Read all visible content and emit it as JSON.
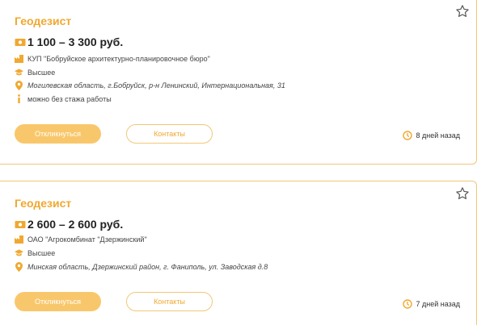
{
  "colors": {
    "accent": "#f0a830",
    "button_fill": "#f9c76b",
    "border": "#f0c878",
    "text": "#333333"
  },
  "vacancies": [
    {
      "title": "Геодезист",
      "salary": "1 100 – 3 300 руб.",
      "company": "КУП \"Бобруйское архитектурно-планировочное бюро\"",
      "education": "Высшее",
      "address": "Могилевская область, г.Бобруйск, р-н Ленинский, Интернациональная, 31",
      "experience": "можно без стажа работы",
      "apply_label": "Откликнуться",
      "contacts_label": "Контакты",
      "posted": "8 дней назад"
    },
    {
      "title": "Геодезист",
      "salary": "2 600 – 2 600 руб.",
      "company": "ОАО \"Агрокомбинат \"Дзержинский\"",
      "education": "Высшее",
      "address": "Минская область, Дзержинский район, г. Фаниполь, ул. Заводская д.8",
      "apply_label": "Откликнуться",
      "contacts_label": "Контакты",
      "posted": "7 дней назад"
    }
  ],
  "icons": {
    "star": "star-icon",
    "money": "money-icon",
    "company": "building-icon",
    "education": "graduation-cap-icon",
    "location": "location-pin-icon",
    "info": "info-icon",
    "clock": "clock-icon"
  }
}
